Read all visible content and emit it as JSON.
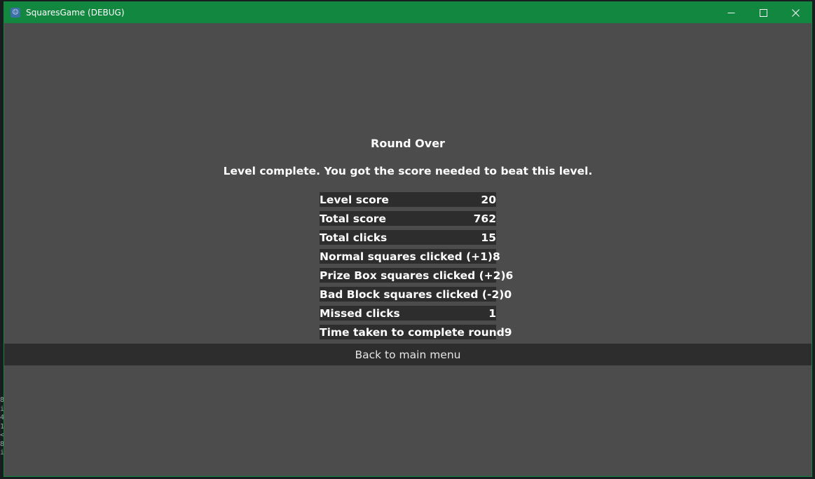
{
  "window": {
    "title": "SquaresGame (DEBUG)",
    "accent_color": "#12873f",
    "background_color": "#4c4c4c",
    "icons": [
      "godot-app-icon",
      "minimize-icon",
      "maximize-icon",
      "close-icon"
    ]
  },
  "round": {
    "heading": "Round Over",
    "message": "Level complete. You got the score needed to beat this level.",
    "stats": [
      {
        "label": "Level score",
        "value": "20"
      },
      {
        "label": "Total score",
        "value": "762"
      },
      {
        "label": "Total clicks",
        "value": "15"
      },
      {
        "label": "Normal squares clicked (+1)",
        "value": "8"
      },
      {
        "label": "Prize Box squares clicked (+2)",
        "value": "6"
      },
      {
        "label": "Bad Block squares clicked (-2)",
        "value": "0"
      },
      {
        "label": "Missed clicks",
        "value": "1"
      },
      {
        "label": "Time taken to complete round",
        "value": "9"
      }
    ],
    "back_button_label": "Back to main menu"
  }
}
